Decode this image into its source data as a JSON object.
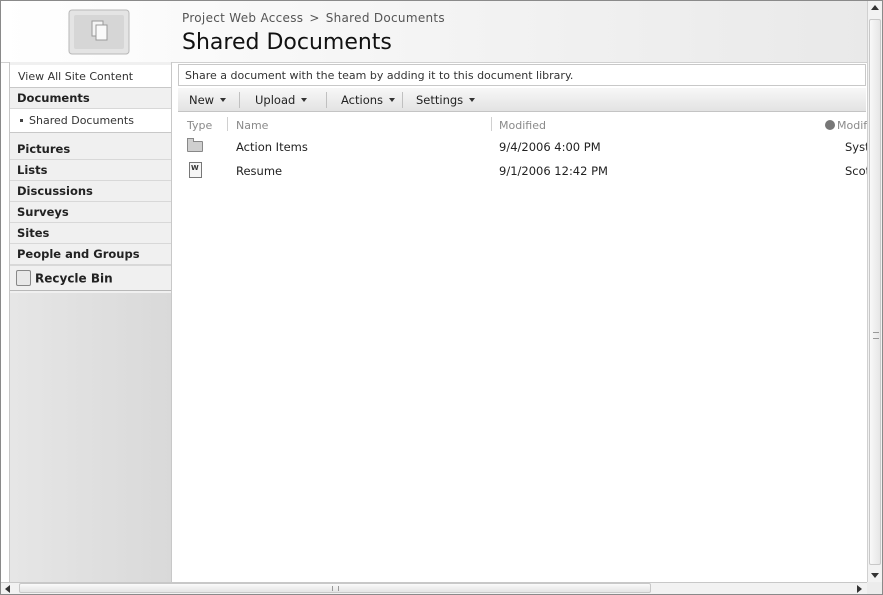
{
  "header": {
    "breadcrumb": [
      "Project Web Access",
      "Shared Documents"
    ],
    "breadcrumb_separator": ">",
    "title": "Shared Documents",
    "site_icon": "document-library-icon"
  },
  "leftnav": {
    "view_all": "View All Site Content",
    "documents_heading": "Documents",
    "shared_documents": "Shared Documents",
    "headings": [
      "Pictures",
      "Lists",
      "Discussions",
      "Surveys",
      "Sites",
      "People and Groups"
    ],
    "recycle_bin": "Recycle Bin"
  },
  "main": {
    "description": "Share a document with the team by adding it to this document library.",
    "toolbar": {
      "new": "New",
      "upload": "Upload",
      "actions": "Actions",
      "settings": "Settings"
    },
    "columns": {
      "type": "Type",
      "name": "Name",
      "modified": "Modified",
      "modified_by": "Modif"
    },
    "rows": [
      {
        "icon": "folder-icon",
        "name": "Action Items",
        "modified": "9/4/2006 4:00 PM",
        "modified_by": "Syste"
      },
      {
        "icon": "word-document-icon",
        "name": "Resume",
        "modified": "9/1/2006 12:42 PM",
        "modified_by": "Scott"
      }
    ]
  },
  "colors": {
    "nav_background": "#f0f0f0",
    "toolbar_gradient_top": "#f7f7f7",
    "toolbar_gradient_bottom": "#e3e3e3"
  }
}
